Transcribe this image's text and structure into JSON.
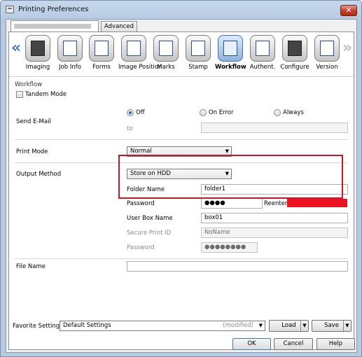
{
  "window": {
    "title": "Printing Preferences",
    "close_glyph": "✕"
  },
  "tabs": [
    {
      "label": ""
    },
    {
      "label": "Advanced"
    }
  ],
  "iconbar": {
    "left_arrow": "«",
    "right_arrow": "»",
    "tools": [
      {
        "label": "Imaging",
        "icon": "imaging-icon"
      },
      {
        "label": "Job Info",
        "icon": "job-info-icon"
      },
      {
        "label": "Forms",
        "icon": "forms-icon"
      },
      {
        "label": "Image Position",
        "icon": "image-position-icon"
      },
      {
        "label": "Marks",
        "icon": "marks-icon"
      },
      {
        "label": "Stamp",
        "icon": "stamp-icon"
      },
      {
        "label": "Workflow",
        "icon": "workflow-icon",
        "selected": true
      },
      {
        "label": "Authent.",
        "icon": "authentication-icon"
      },
      {
        "label": "Configure",
        "icon": "configure-icon"
      },
      {
        "label": "Version",
        "icon": "version-icon"
      }
    ]
  },
  "workflow": {
    "group_label": "Workflow",
    "tandem_mode_label": "Tandem Mode",
    "send_email": {
      "label": "Send E-Mail",
      "options": [
        "Off",
        "On Error",
        "Always"
      ],
      "selected": "Off",
      "to_label": "to",
      "to_value": ""
    },
    "print_mode": {
      "label": "Print Mode",
      "value": "Normal"
    },
    "output_method": {
      "label": "Output Method",
      "value": "Store on HDD"
    },
    "folder_name": {
      "label": "Folder Name",
      "value": "folder1"
    },
    "password": {
      "label": "Password",
      "value": "●●●●",
      "reenter_label": "Reenter"
    },
    "user_box_name": {
      "label": "User Box Name",
      "value": "box01"
    },
    "secure_print_id": {
      "label": "Secure Print ID",
      "value": "NoName"
    },
    "secure_password": {
      "label": "Password",
      "value": "●●●●●●●●"
    },
    "file_name": {
      "label": "File Name",
      "value": ""
    }
  },
  "footer": {
    "favorite_label": "Favorite Setting",
    "favorite_value": "Default Settings",
    "modified": "(modified)",
    "load_label": "Load",
    "save_label": "Save"
  },
  "dialog_buttons": {
    "ok": "OK",
    "cancel": "Cancel",
    "help": "Help"
  },
  "colors": {
    "highlight": "#d0142a",
    "selected_tool": "#3c6fb4"
  }
}
